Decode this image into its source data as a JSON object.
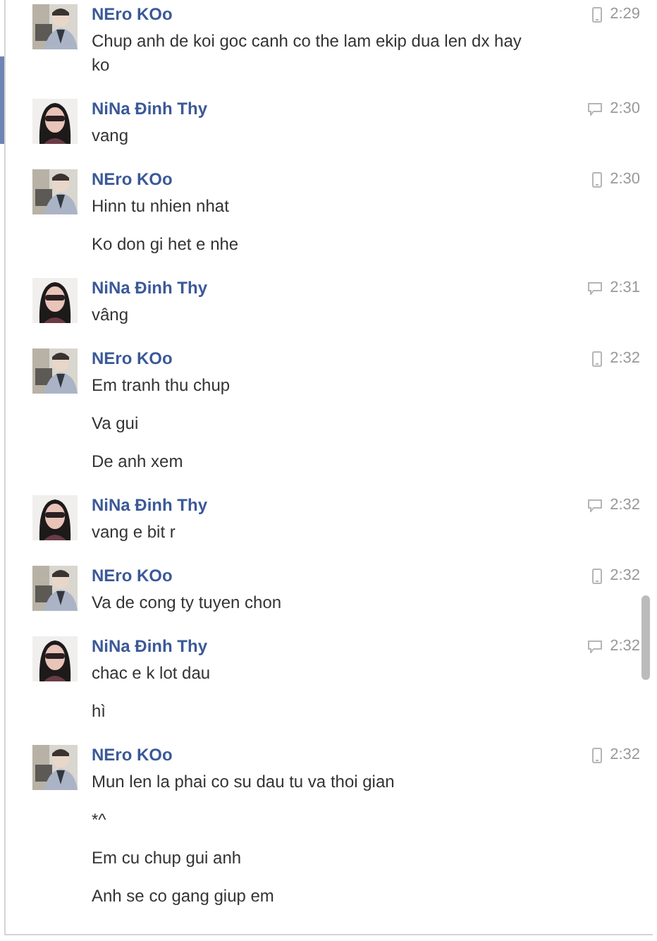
{
  "messages": [
    {
      "sender": "NEro KOo",
      "kind": "mobile",
      "time": "2:29",
      "lines": [
        "Chup anh de koi goc canh co the lam ekip dua len dx hay ko"
      ]
    },
    {
      "sender": "NiNa Đinh Thy",
      "kind": "chat",
      "time": "2:30",
      "lines": [
        "vang"
      ]
    },
    {
      "sender": "NEro KOo",
      "kind": "mobile",
      "time": "2:30",
      "lines": [
        "Hinn tu nhien nhat",
        "Ko don gi het e nhe"
      ]
    },
    {
      "sender": "NiNa Đinh Thy",
      "kind": "chat",
      "time": "2:31",
      "lines": [
        "vâng"
      ]
    },
    {
      "sender": "NEro KOo",
      "kind": "mobile",
      "time": "2:32",
      "lines": [
        "Em tranh thu chup",
        "Va gui",
        "De anh xem"
      ]
    },
    {
      "sender": "NiNa Đinh Thy",
      "kind": "chat",
      "time": "2:32",
      "lines": [
        "vang e bit r"
      ]
    },
    {
      "sender": "NEro KOo",
      "kind": "mobile",
      "time": "2:32",
      "lines": [
        "Va de cong ty tuyen chon"
      ]
    },
    {
      "sender": "NiNa Đinh Thy",
      "kind": "chat",
      "time": "2:32",
      "lines": [
        "chac e k lot dau",
        "hì"
      ]
    },
    {
      "sender": "NEro KOo",
      "kind": "mobile",
      "time": "2:32",
      "lines": [
        "Mun len la phai co su dau tu va thoi gian",
        "*^",
        "Em cu chup gui anh",
        "Anh se co gang giup em"
      ]
    }
  ]
}
